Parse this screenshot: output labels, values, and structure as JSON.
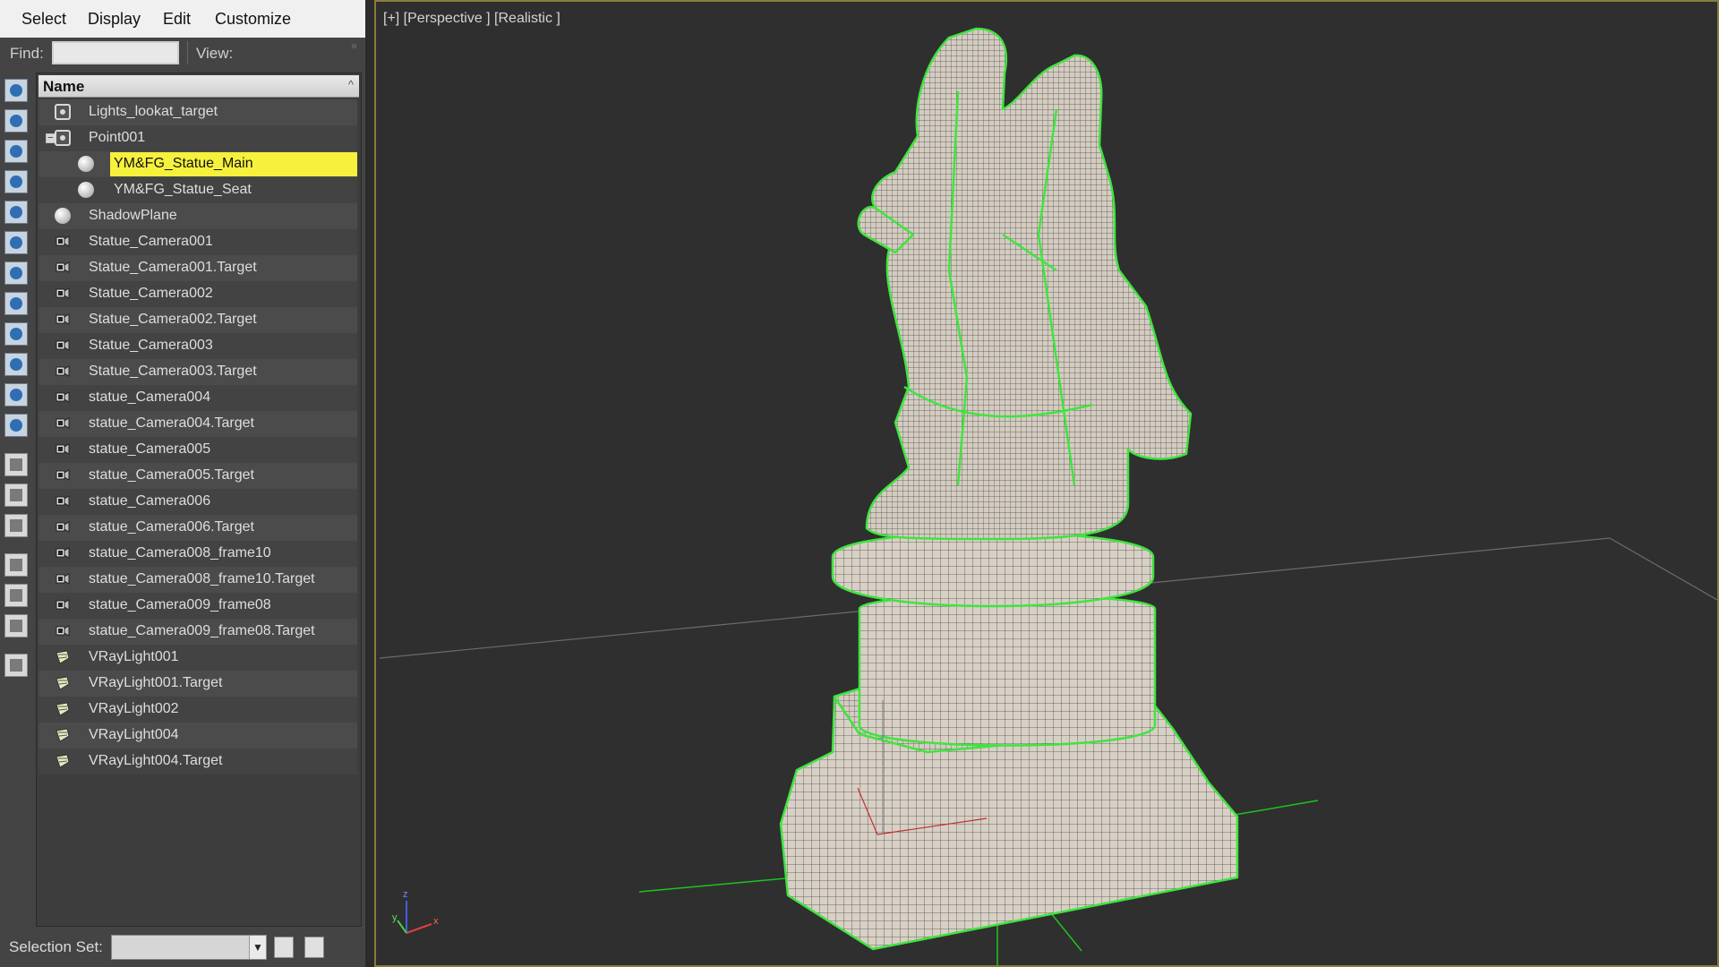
{
  "menubar": {
    "items": [
      "Select",
      "Display",
      "Edit",
      "Customize"
    ]
  },
  "findbar": {
    "find_label": "Find:",
    "find_value": "",
    "view_label": "View:"
  },
  "tree": {
    "column_header": "Name",
    "rows": [
      {
        "label": "Lights_lookat_target",
        "icon": "point-helper-icon"
      },
      {
        "label": "Point001",
        "icon": "point-helper-icon",
        "expander": "−"
      },
      {
        "label": "YM&FG_Statue_Main",
        "icon": "geometry-sphere-icon",
        "selected": true
      },
      {
        "label": "YM&FG_Statue_Seat",
        "icon": "geometry-sphere-icon"
      },
      {
        "label": "ShadowPlane",
        "icon": "geometry-sphere-icon"
      },
      {
        "label": "Statue_Camera001",
        "icon": "camera-icon"
      },
      {
        "label": "Statue_Camera001.Target",
        "icon": "camera-icon"
      },
      {
        "label": "Statue_Camera002",
        "icon": "camera-icon"
      },
      {
        "label": "Statue_Camera002.Target",
        "icon": "camera-icon"
      },
      {
        "label": "Statue_Camera003",
        "icon": "camera-icon"
      },
      {
        "label": "Statue_Camera003.Target",
        "icon": "camera-icon"
      },
      {
        "label": "statue_Camera004",
        "icon": "camera-icon"
      },
      {
        "label": "statue_Camera004.Target",
        "icon": "camera-icon"
      },
      {
        "label": "statue_Camera005",
        "icon": "camera-icon"
      },
      {
        "label": "statue_Camera005.Target",
        "icon": "camera-icon"
      },
      {
        "label": "statue_Camera006",
        "icon": "camera-icon"
      },
      {
        "label": "statue_Camera006.Target",
        "icon": "camera-icon"
      },
      {
        "label": "statue_Camera008_frame10",
        "icon": "camera-icon"
      },
      {
        "label": "statue_Camera008_frame10.Target",
        "icon": "camera-icon"
      },
      {
        "label": "statue_Camera009_frame08",
        "icon": "camera-icon"
      },
      {
        "label": "statue_Camera009_frame08.Target",
        "icon": "camera-icon"
      },
      {
        "label": "VRayLight001",
        "icon": "light-icon"
      },
      {
        "label": "VRayLight001.Target",
        "icon": "light-icon"
      },
      {
        "label": "VRayLight002",
        "icon": "light-icon"
      },
      {
        "label": "VRayLight004",
        "icon": "light-icon"
      },
      {
        "label": "VRayLight004.Target",
        "icon": "light-icon"
      }
    ]
  },
  "selection_set": {
    "label": "Selection Set:",
    "value": ""
  },
  "viewport": {
    "label": "[+] [Perspective ] [Realistic ]",
    "axis_labels": {
      "x": "x",
      "y": "y",
      "z": "z"
    }
  },
  "colors": {
    "selected_row": "#f6f13c",
    "wireframe_green": "#3fe43f",
    "viewport_border": "#8a7b3d",
    "mesh_fill": "#d8d0c4"
  }
}
